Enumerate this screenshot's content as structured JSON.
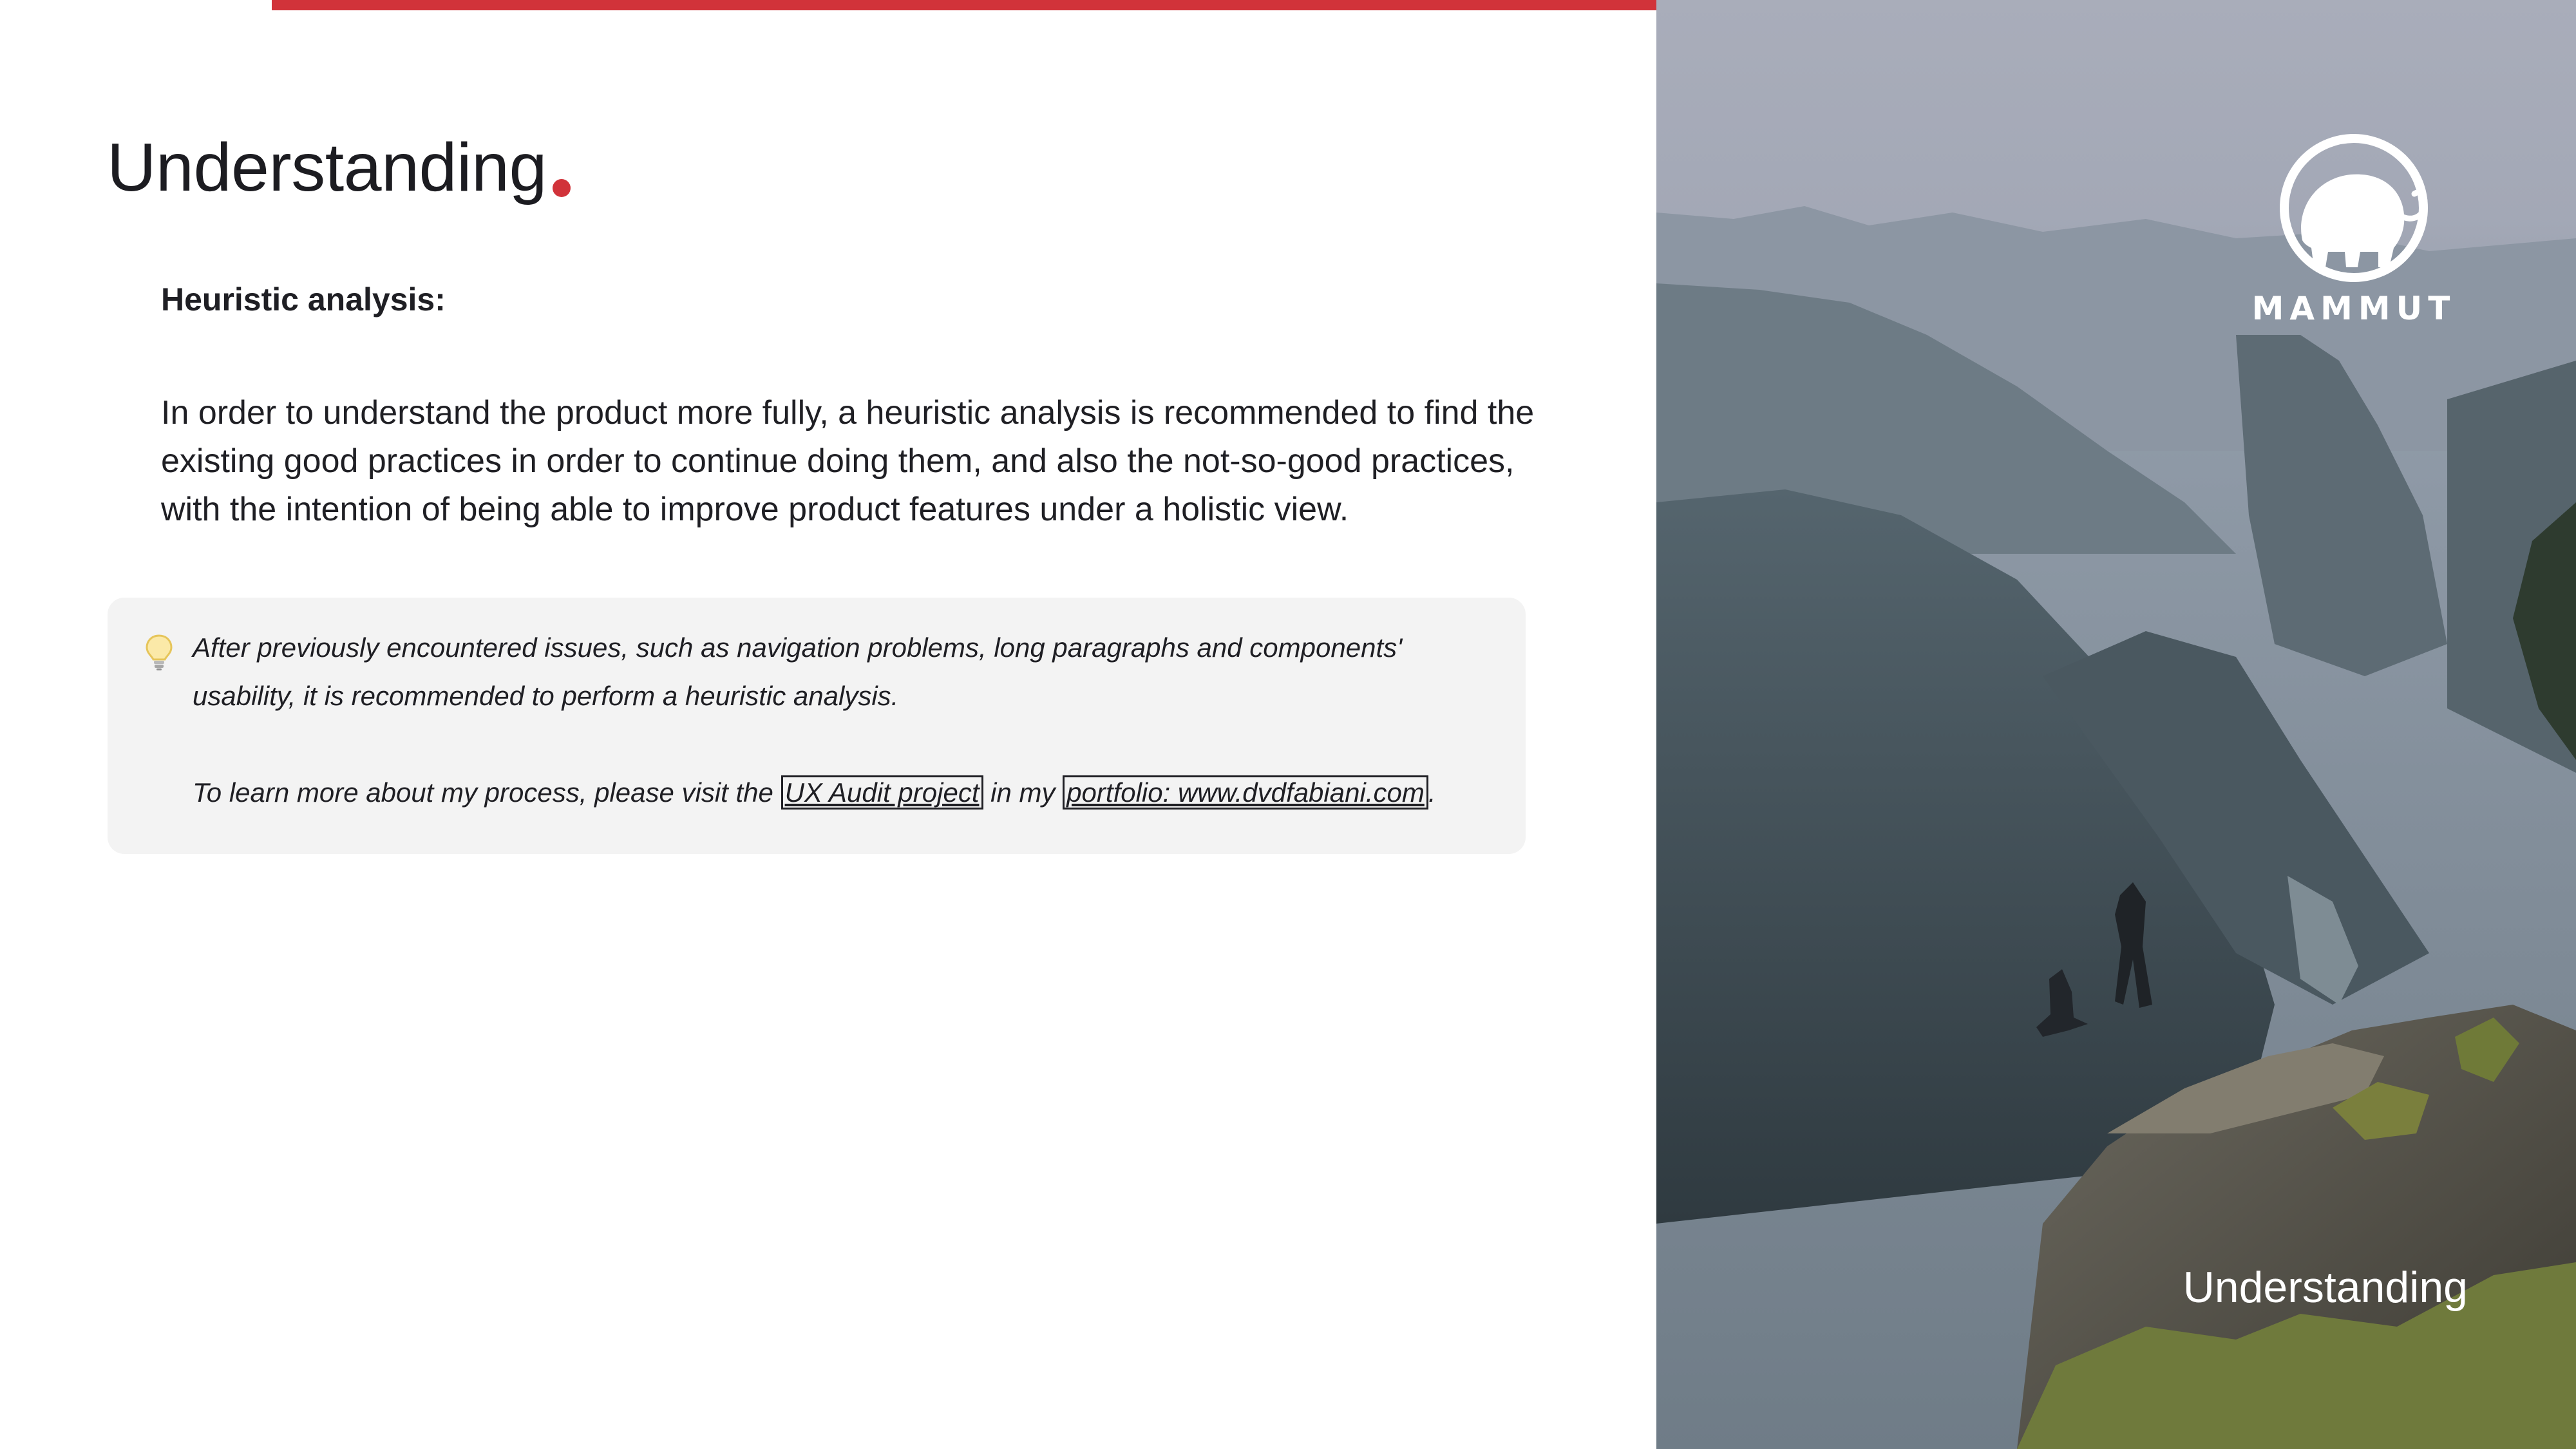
{
  "page": {
    "title": "Understanding",
    "subtitle": "Heuristic analysis:",
    "intro": "In order to understand the product more fully, a heuristic analysis is recommended to find the existing good practices in order to continue doing them, and also the not-so-good practices, with the intention of being able to improve product features under a holistic view."
  },
  "callout": {
    "icon": "lightbulb-icon",
    "paragraph1": "After previously encountered issues, such as navigation problems, long paragraphs and components' usability, it is recommended to perform a heuristic analysis.",
    "paragraph2_prefix": "To learn more about my process, please visit the",
    "link_audit": "UX Audit project",
    "paragraph2_middle": "in my",
    "link_portfolio": "portfolio: www.dvdfabiani.com",
    "paragraph2_suffix": "."
  },
  "side_panel": {
    "brand": "MAMMUT",
    "caption": "Understanding"
  },
  "colors": {
    "accent": "#d1333a",
    "text": "#1f1f24",
    "callout_bg": "#f3f3f3"
  }
}
